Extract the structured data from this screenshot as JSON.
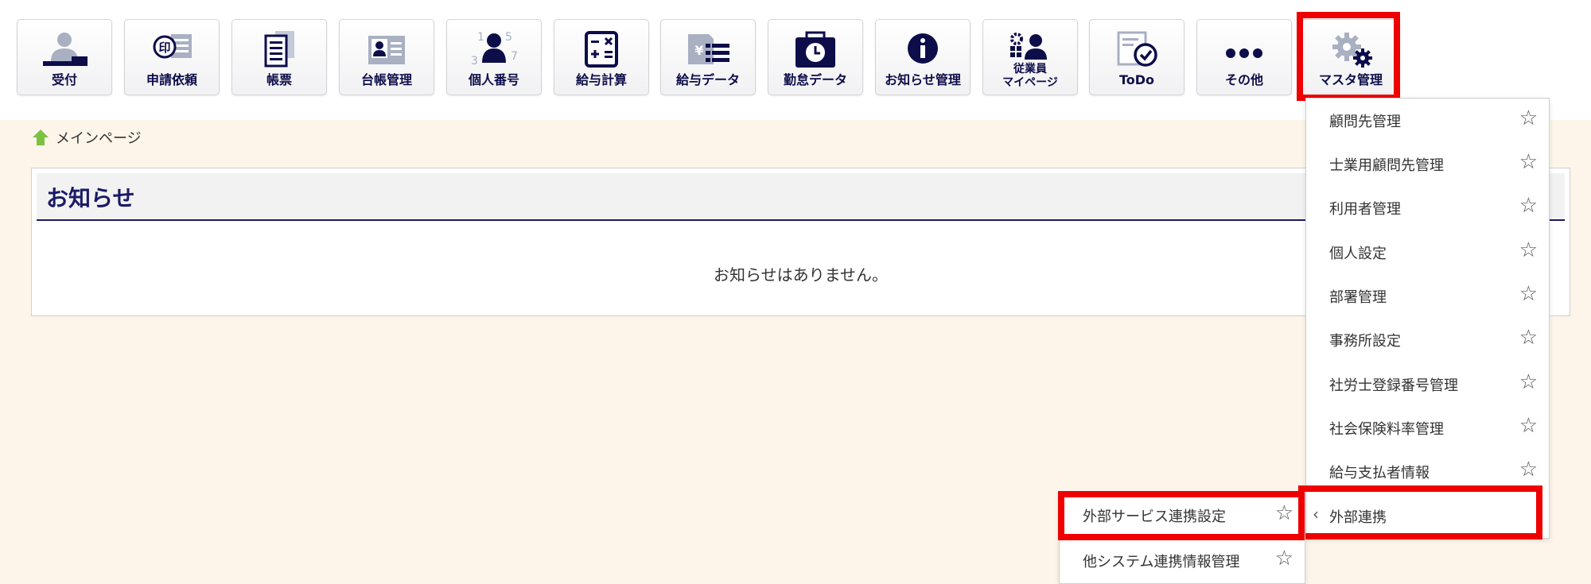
{
  "toolbar": {
    "tiles": [
      {
        "label": "受付",
        "icon": "reception-icon"
      },
      {
        "label": "申請依頼",
        "icon": "seal-document-icon"
      },
      {
        "label": "帳票",
        "icon": "forms-icon"
      },
      {
        "label": "台帳管理",
        "icon": "ledger-card-icon"
      },
      {
        "label": "個人番号",
        "icon": "personal-number-icon"
      },
      {
        "label": "給与計算",
        "icon": "calculator-icon"
      },
      {
        "label": "給与データ",
        "icon": "salary-data-icon"
      },
      {
        "label": "勤怠データ",
        "icon": "attendance-clock-icon"
      },
      {
        "label": "お知らせ管理",
        "icon": "info-icon"
      },
      {
        "label": "従業員\nマイページ",
        "icon": "employee-page-icon"
      },
      {
        "label": "ToDo",
        "icon": "todo-check-icon"
      },
      {
        "label": "その他",
        "icon": "more-dots-icon"
      },
      {
        "label": "マスタ管理",
        "icon": "gears-icon"
      }
    ]
  },
  "breadcrumb": {
    "label": "メインページ"
  },
  "notice_panel": {
    "title": "お知らせ",
    "message": "お知らせはありません。"
  },
  "master_menu": {
    "items": [
      {
        "label": "顧問先管理"
      },
      {
        "label": "士業用顧問先管理"
      },
      {
        "label": "利用者管理"
      },
      {
        "label": "個人設定"
      },
      {
        "label": "部署管理"
      },
      {
        "label": "事務所設定"
      },
      {
        "label": "社労士登録番号管理"
      },
      {
        "label": "社会保険料率管理"
      },
      {
        "label": "給与支払者情報"
      },
      {
        "label": "外部連携"
      }
    ],
    "star_glyph": "☆",
    "chevron_glyph": "‹"
  },
  "external_submenu": {
    "items": [
      {
        "label": "外部サービス連携設定"
      },
      {
        "label": "他システム連携情報管理"
      }
    ]
  },
  "colors": {
    "accent_navy": "#1a1a66",
    "highlight_red": "#ee0000",
    "content_bg": "#fef5ea",
    "home_green": "#7cc242"
  }
}
